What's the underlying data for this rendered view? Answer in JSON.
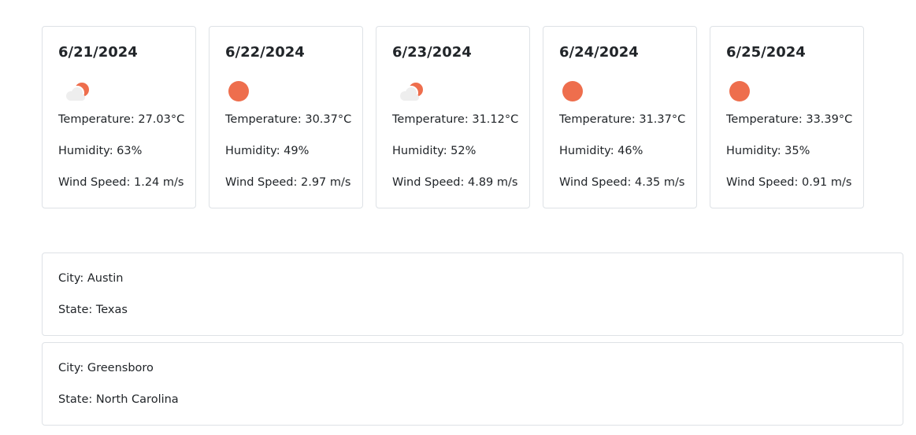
{
  "forecast": [
    {
      "date": "6/21/2024",
      "icon": "partly-cloudy-icon",
      "temperature": "Temperature: 27.03°C",
      "humidity": "Humidity: 63%",
      "wind": "Wind Speed: 1.24 m/s"
    },
    {
      "date": "6/22/2024",
      "icon": "sun-icon",
      "temperature": "Temperature: 30.37°C",
      "humidity": "Humidity: 49%",
      "wind": "Wind Speed: 2.97 m/s"
    },
    {
      "date": "6/23/2024",
      "icon": "partly-cloudy-icon",
      "temperature": "Temperature: 31.12°C",
      "humidity": "Humidity: 52%",
      "wind": "Wind Speed: 4.89 m/s"
    },
    {
      "date": "6/24/2024",
      "icon": "sun-icon",
      "temperature": "Temperature: 31.37°C",
      "humidity": "Humidity: 46%",
      "wind": "Wind Speed: 4.35 m/s"
    },
    {
      "date": "6/25/2024",
      "icon": "sun-icon",
      "temperature": "Temperature: 33.39°C",
      "humidity": "Humidity: 35%",
      "wind": "Wind Speed: 0.91 m/s"
    }
  ],
  "locations": [
    {
      "city": "City: Austin",
      "state": "State: Texas"
    },
    {
      "city": "City: Greensboro",
      "state": "State: North Carolina"
    }
  ],
  "colors": {
    "sun": "#ee6e4d",
    "cloud": "#eeeeee",
    "border": "#dee2e6",
    "text": "#212529"
  }
}
